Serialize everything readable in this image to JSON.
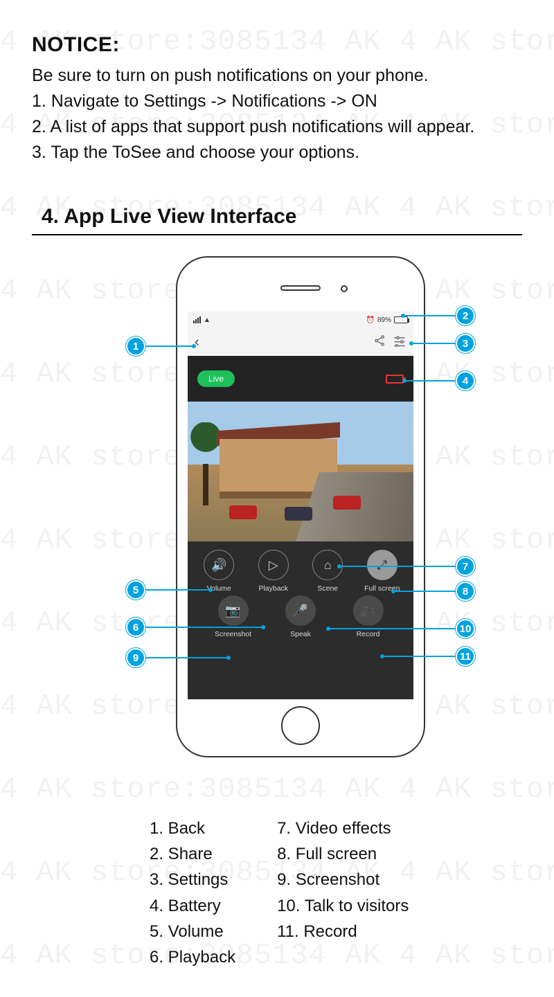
{
  "watermark_text": "4 AK store:3085134 AK 4 AK store:3085134 AK",
  "notice": {
    "heading": "NOTICE:",
    "intro": "Be sure to turn on push notifications on your phone.",
    "steps": [
      "1. Navigate to Settings -> Notifications -> ON",
      "2. A list of apps that support push notifications will appear.",
      "3. Tap the ToSee and choose your options."
    ]
  },
  "section_title": "4. App Live View Interface",
  "statusbar": {
    "battery_pct": "89%"
  },
  "live_label": "Live",
  "controls_row1": [
    {
      "label": "Volume",
      "icon": "🔊"
    },
    {
      "label": "Playback",
      "icon": "▷"
    },
    {
      "label": "Scene",
      "icon": "⌂"
    },
    {
      "label": "Full screen",
      "icon": "⤢"
    }
  ],
  "controls_row2": [
    {
      "label": "Screenshot",
      "icon": "📷"
    },
    {
      "label": "Speak",
      "icon": "🎤"
    },
    {
      "label": "Record",
      "icon": "🎥"
    }
  ],
  "callouts": [
    "1",
    "2",
    "3",
    "4",
    "5",
    "6",
    "7",
    "8",
    "9",
    "10",
    "11"
  ],
  "legend_left": [
    "1. Back",
    "2. Share",
    "3. Settings",
    "4. Battery",
    "5. Volume",
    "6. Playback"
  ],
  "legend_right": [
    "7. Video effects",
    "8. Full screen",
    "9. Screenshot",
    "10. Talk to visitors",
    "11. Record"
  ]
}
